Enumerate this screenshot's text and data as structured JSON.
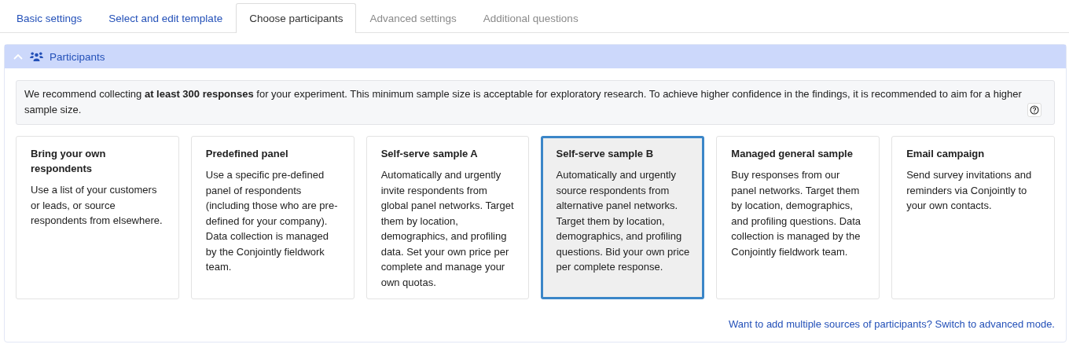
{
  "tabs": [
    {
      "label": "Basic settings",
      "selected": false,
      "disabled": false
    },
    {
      "label": "Select and edit template",
      "selected": false,
      "disabled": false
    },
    {
      "label": "Choose participants",
      "selected": true,
      "disabled": false
    },
    {
      "label": "Advanced settings",
      "selected": false,
      "disabled": true
    },
    {
      "label": "Additional questions",
      "selected": false,
      "disabled": true
    }
  ],
  "panel": {
    "title": "Participants",
    "expanded": true,
    "notice": "We recommend collecting **at least 300 responses** for your experiment. This minimum sample size is acceptable for exploratory research. To achieve higher confidence in the findings, it is recommended to aim for a higher sample size.",
    "options": [
      {
        "title": "Bring your own respondents",
        "description": "Use a list of your customers or leads, or source respondents from elsewhere.",
        "selected": false
      },
      {
        "title": "Predefined panel",
        "description": "Use a specific pre-defined panel of respondents (including those who are pre-defined for your company). Data collection is managed by the Conjointly fieldwork team.",
        "selected": false
      },
      {
        "title": "Self-serve sample A",
        "description": "Automatically and urgently invite respondents from global panel networks. Target them by location, demographics, and profiling data. Set your own price per complete and manage your own quotas.",
        "selected": false
      },
      {
        "title": "Self-serve sample B",
        "description": "Automatically and urgently source respondents from alternative panel networks. Target them by location, demographics, and profiling questions. Bid your own price per complete response.",
        "selected": true
      },
      {
        "title": "Managed general sample",
        "description": "Buy responses from our panel networks. Target them by location, demographics, and profiling questions. Data collection is managed by the Conjointly fieldwork team.",
        "selected": false
      },
      {
        "title": "Email campaign",
        "description": "Send survey invitations and reminders via Conjointly to your own contacts.",
        "selected": false
      }
    ],
    "advanced_link": "Want to add multiple sources of participants? Switch to advanced mode."
  }
}
